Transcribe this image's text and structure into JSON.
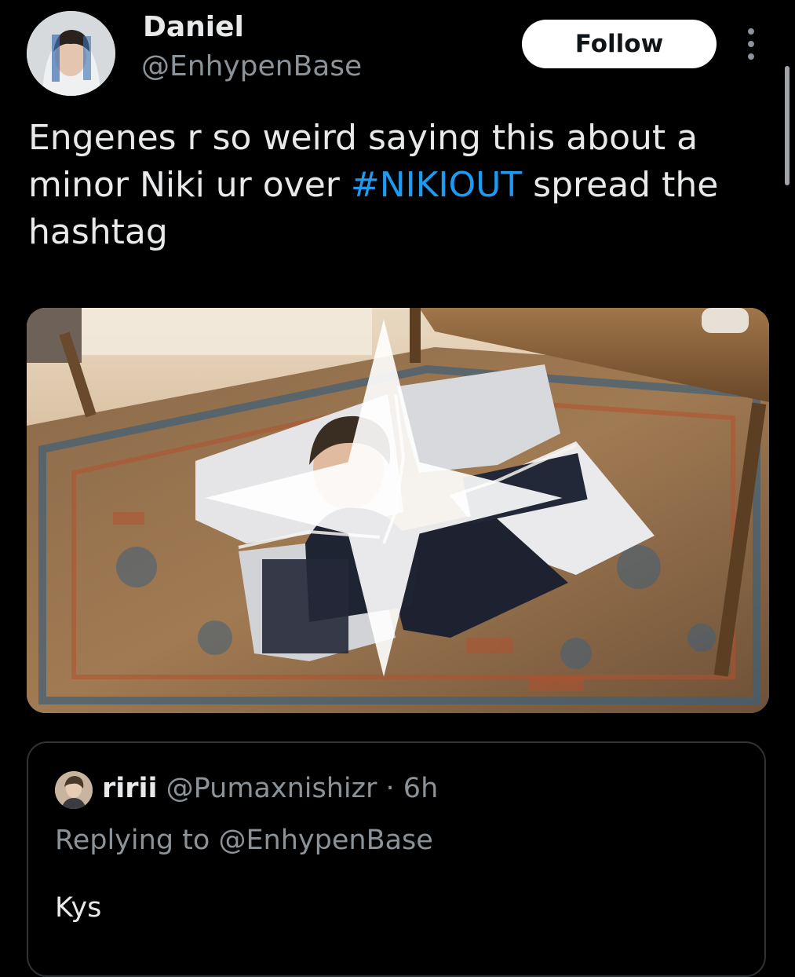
{
  "author": {
    "display_name": "Daniel",
    "handle": "@EnhypenBase"
  },
  "header": {
    "follow_label": "Follow",
    "more_icon": "more-vertical-icon"
  },
  "tweet": {
    "text_before": "Engenes r so weird saying this about a minor Niki ur over ",
    "hashtag": "#NIKIOUT",
    "text_after": " spread the hashtag"
  },
  "media": {
    "description_icon": "sparkle-icon"
  },
  "quote": {
    "display_name": "ririi",
    "handle": "@Pumaxnishizr",
    "separator": " · ",
    "time": "6h",
    "replying_to": "Replying to @EnhypenBase",
    "text": "Kys"
  },
  "colors": {
    "background": "#000000",
    "text": "#e7e9ea",
    "secondary_text": "#8b9298",
    "link": "#1d9bf0",
    "border": "#2f3336",
    "follow_bg": "#ffffff"
  }
}
